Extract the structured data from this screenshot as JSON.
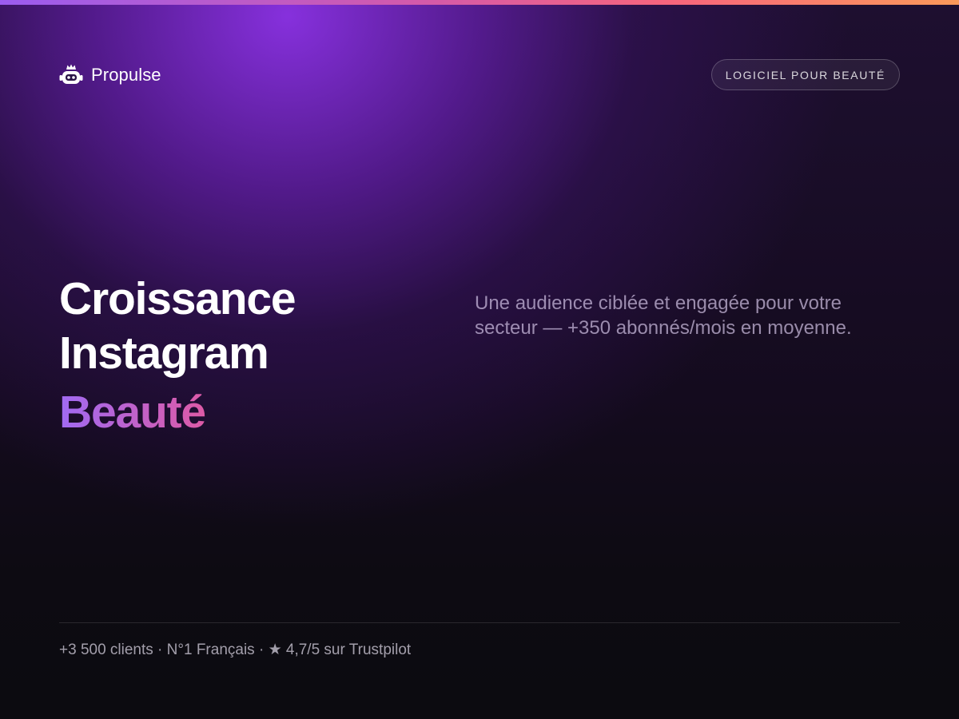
{
  "brand": {
    "name": "Propulse",
    "icon": "robot-crown-icon"
  },
  "badge": {
    "label": "LOGICIEL POUR BEAUTÉ"
  },
  "hero": {
    "title_line1": "Croissance",
    "title_line2": "Instagram",
    "title_accent": "Beauté",
    "subtitle": "Une audience ciblée et engagée pour votre secteur — +350 abonnés/mois en moyenne."
  },
  "footer": {
    "stats": "+3 500 clients · N°1 Français · ★ 4,7/5 sur Trustpilot"
  },
  "colors": {
    "accent_gradient": [
      "#a06af2",
      "#e5589c",
      "#f86670",
      "#fba45a"
    ],
    "background": "#0d0a12",
    "glow": "#8c32e6"
  }
}
